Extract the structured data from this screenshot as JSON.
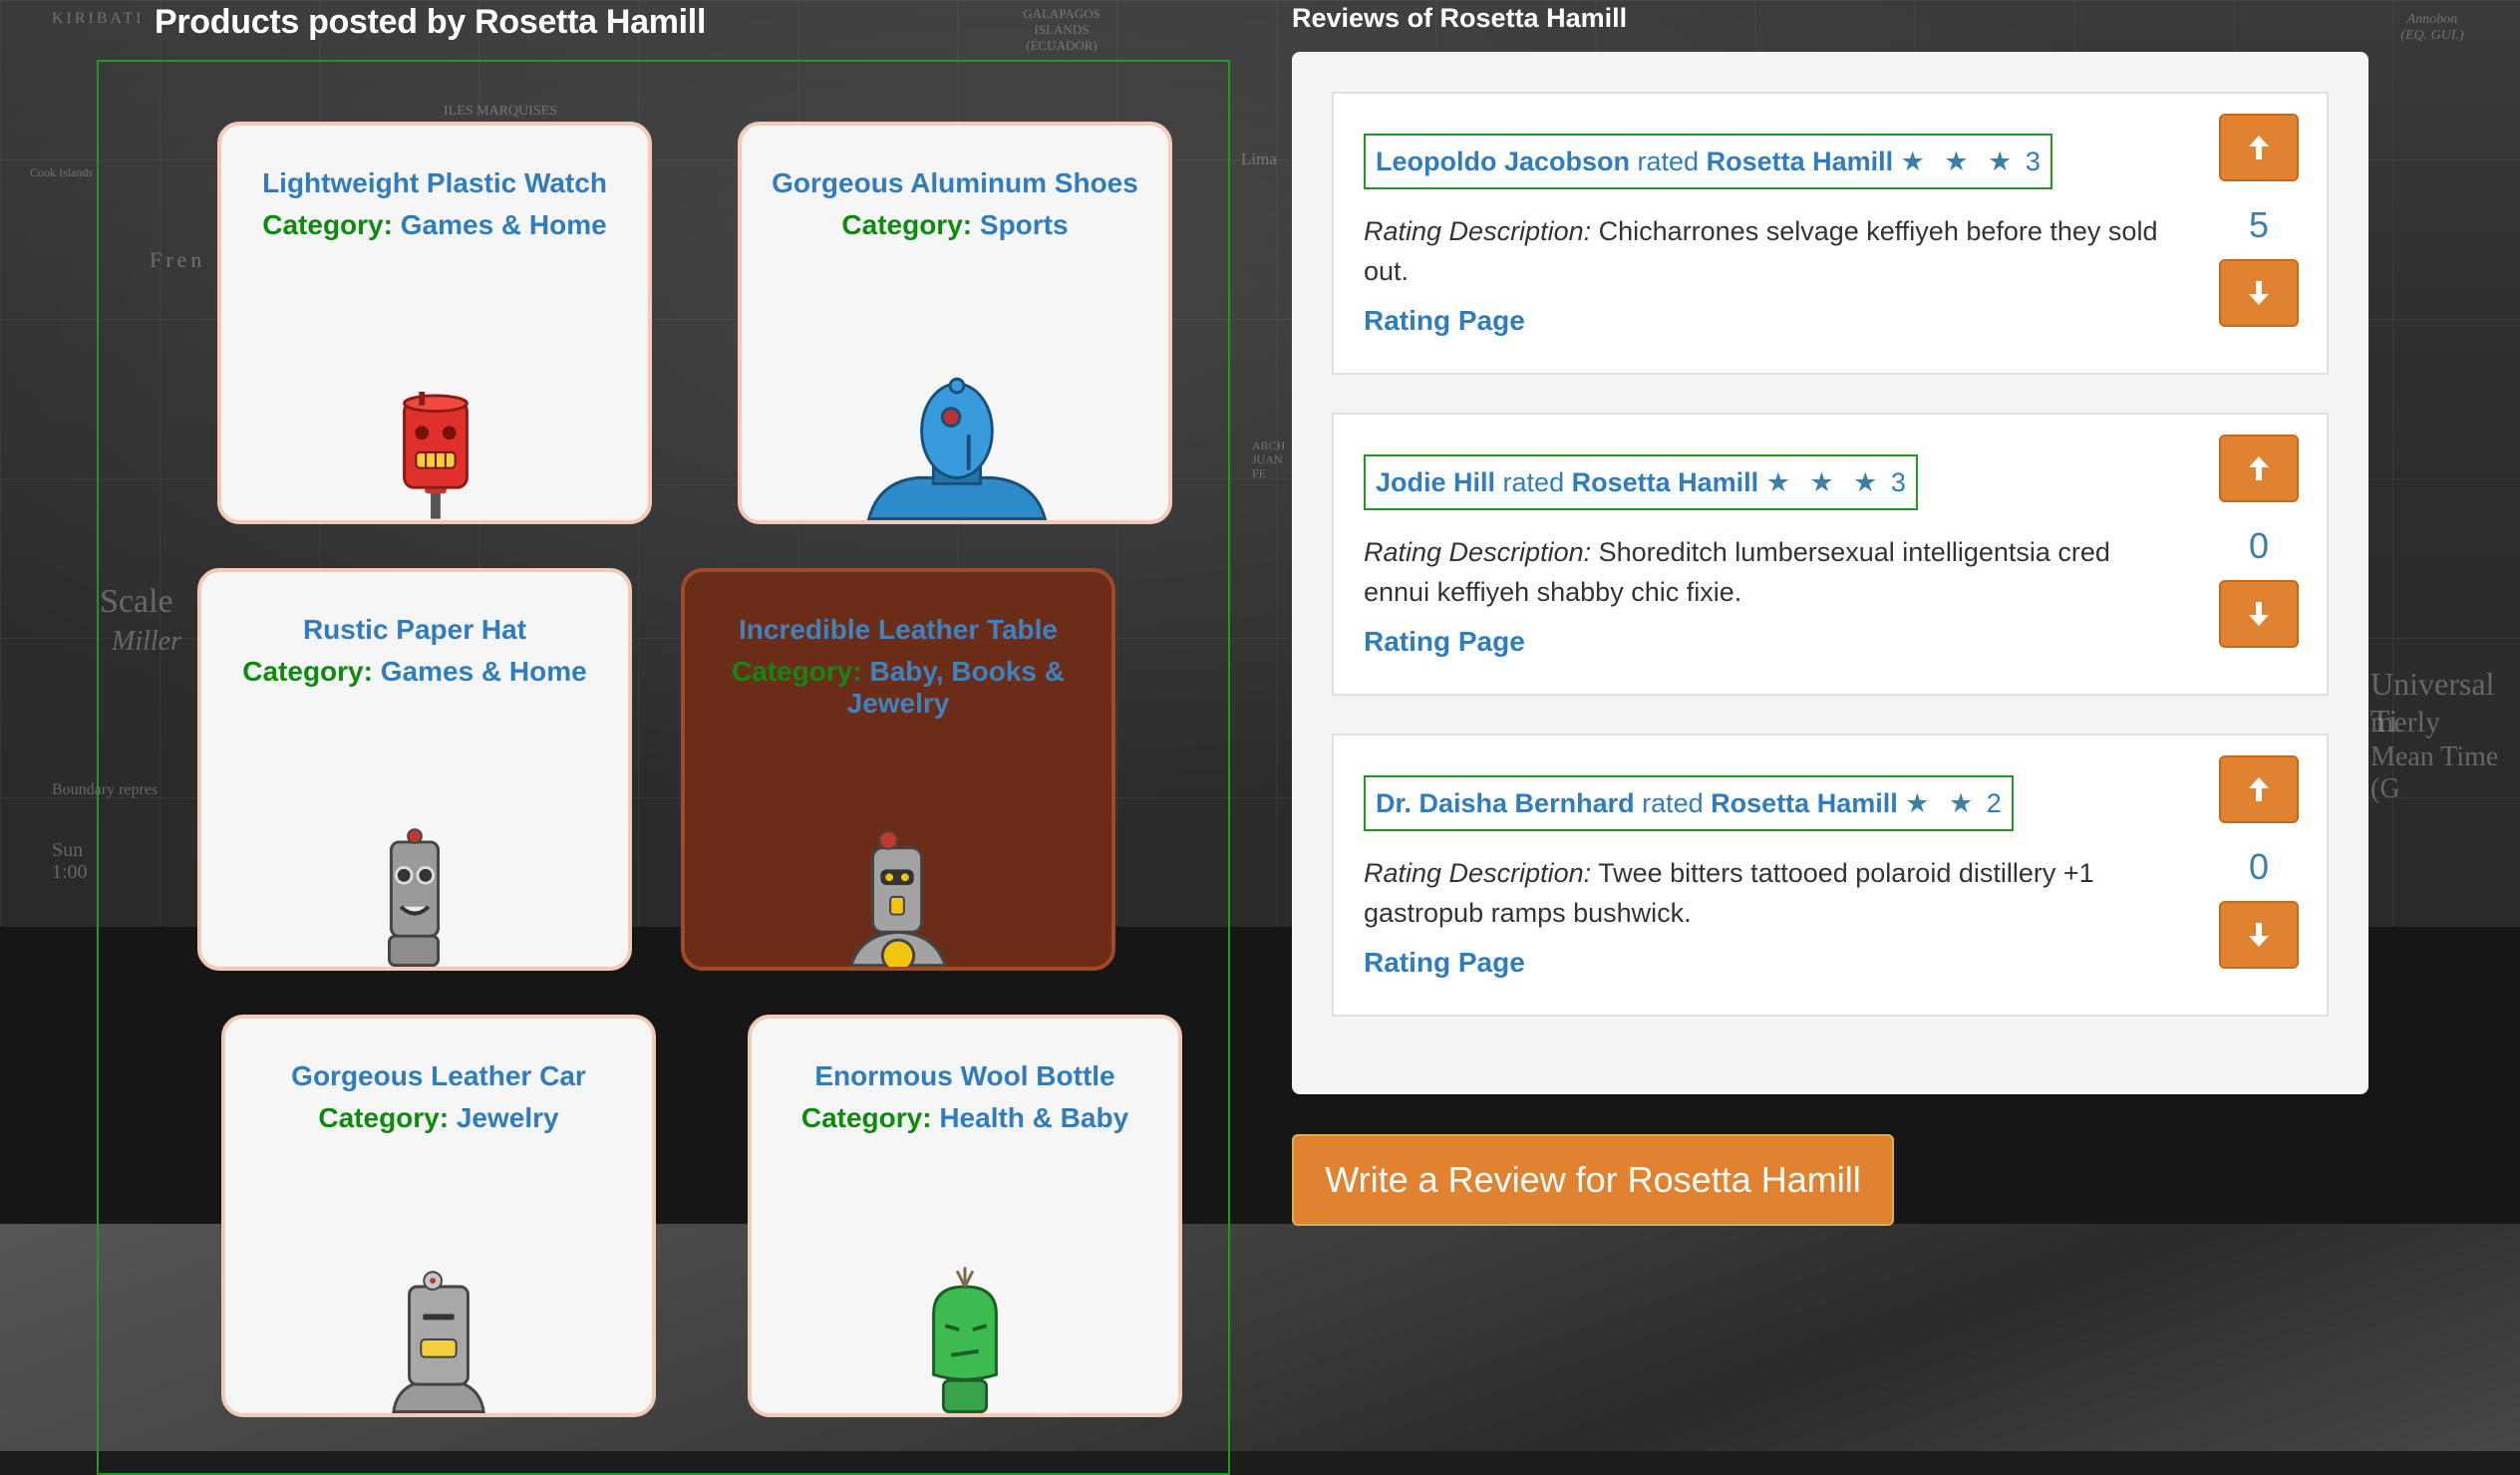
{
  "products": {
    "title": "Products posted by Rosetta Hamill",
    "category_label": "Category:",
    "items": [
      {
        "name": "Lightweight Plastic Watch",
        "category": "Games & Home",
        "robot_icon": "red-robot-icon"
      },
      {
        "name": "Gorgeous Aluminum Shoes",
        "category": "Sports",
        "robot_icon": "blue-robot-icon"
      },
      {
        "name": "Rustic Paper Hat",
        "category": "Games & Home",
        "robot_icon": "gray-robot-icon"
      },
      {
        "name": "Incredible Leather Table",
        "category": "Baby, Books & Jewelry",
        "robot_icon": "gray-robot-icon"
      },
      {
        "name": "Gorgeous Leather Car",
        "category": "Jewelry",
        "robot_icon": "gray-robot-icon"
      },
      {
        "name": "Enormous Wool Bottle",
        "category": "Health & Baby",
        "robot_icon": "green-robot-icon"
      }
    ]
  },
  "reviews": {
    "title": "Reviews of Rosetta Hamill",
    "description_label": "Rating Description:",
    "rated_word": "rated",
    "link_label": "Rating Page",
    "items": [
      {
        "reviewer": "Leopoldo Jacobson",
        "target": "Rosetta Hamill",
        "stars": "★ ★ ★",
        "rating": "3",
        "description": "Chicharrones selvage keffiyeh before they sold out.",
        "votes": "5"
      },
      {
        "reviewer": "Jodie Hill",
        "target": "Rosetta Hamill",
        "stars": "★ ★ ★",
        "rating": "3",
        "description": "Shoreditch lumbersexual intelligentsia cred ennui keffiyeh shabby chic fixie.",
        "votes": "0"
      },
      {
        "reviewer": "Dr. Daisha Bernhard",
        "target": "Rosetta Hamill",
        "stars": "★ ★",
        "rating": "2",
        "description": "Twee bitters tattooed polaroid distillery +1 gastropub ramps bushwick.",
        "votes": "0"
      }
    ]
  },
  "write_review": {
    "label": "Write a Review for Rosetta Hamill"
  },
  "background_map": {
    "labels": [
      "KIRIBATI",
      "GALAPAGOS ISLANDS (ECUADOR)",
      "ILES MARQUISES",
      "Lima",
      "Annobon (EQ. GUI.)",
      "Scale",
      "Miller",
      "Cook Islands",
      "Fren",
      "Sun 1:00",
      "Universal Ti",
      "merly",
      "Mean Time (G",
      "Boundary repres",
      "ARCH JUAN FE"
    ]
  },
  "colors": {
    "accent_orange": "#e0822f",
    "link_blue": "#2f7cbf",
    "category_green": "#0e8a0e",
    "frame_green": "#1f9a1f",
    "card_border": "#f3c9b8",
    "hover_card": "#6b2d18"
  }
}
